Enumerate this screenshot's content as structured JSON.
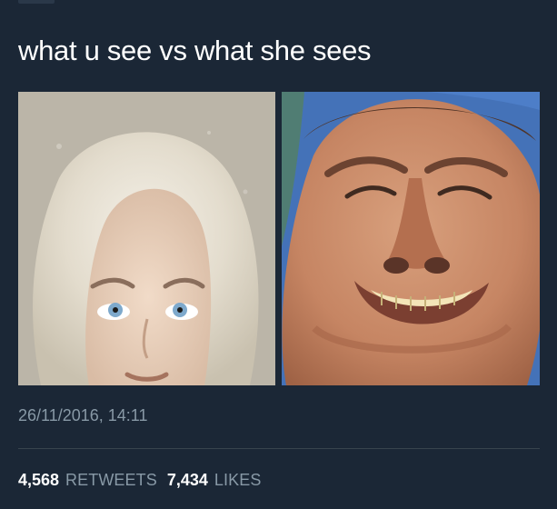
{
  "tweet": {
    "text": "what u see vs what she sees",
    "timestamp": "26/11/2016, 14:11",
    "media": [
      {
        "description": "woman with blonde hair looking up",
        "accent": "#d8d1c4"
      },
      {
        "description": "man smiling from below against blue sky",
        "accent": "#4f7fc7"
      }
    ],
    "stats": {
      "retweets_count": "4,568",
      "retweets_label": "RETWEETS",
      "likes_count": "7,434",
      "likes_label": "LIKES"
    }
  },
  "colors": {
    "background": "#1b2736",
    "text_primary": "#ffffff",
    "text_secondary": "#8899a6",
    "divider": "#38444d"
  }
}
